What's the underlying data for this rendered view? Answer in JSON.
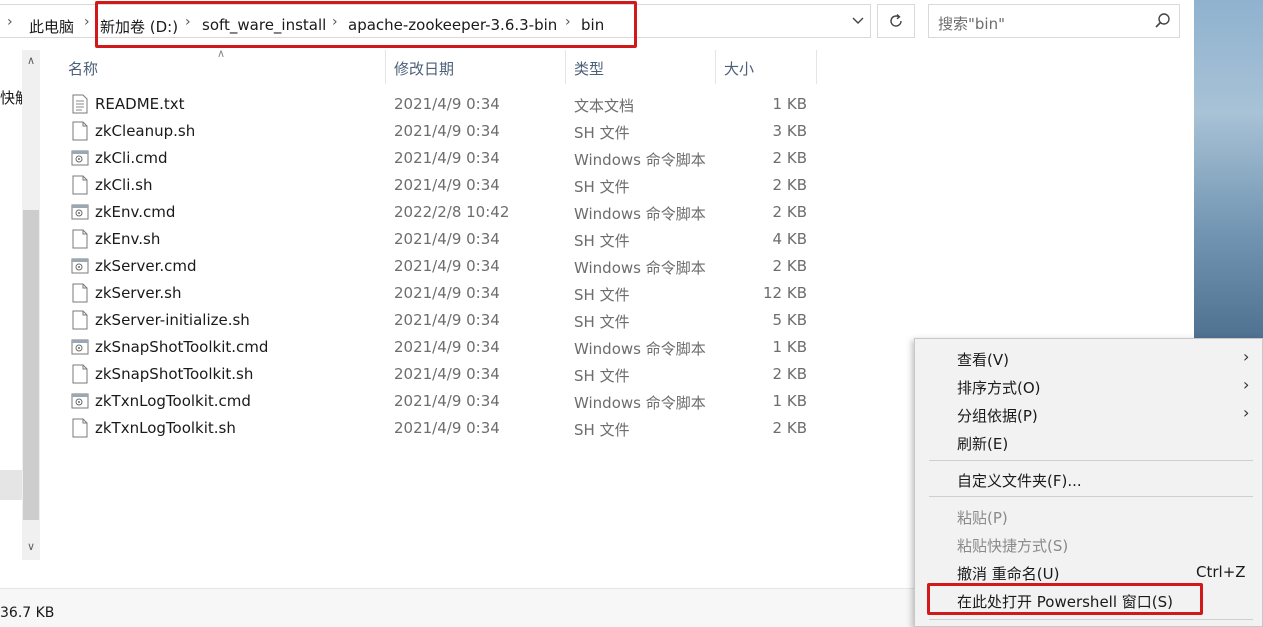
{
  "address_bar": {
    "breadcrumbs": [
      "此电脑",
      "新加卷 (D:)",
      "soft_ware_install",
      "apache-zookeeper-3.6.3-bin",
      "bin"
    ],
    "search_placeholder": "搜索\"bin\""
  },
  "nav": {
    "partial_text": "快解"
  },
  "columns": {
    "name": "名称",
    "date": "修改日期",
    "type": "类型",
    "size": "大小"
  },
  "files": [
    {
      "name": "README.txt",
      "date": "2021/4/9 0:34",
      "type": "文本文档",
      "size": "1 KB",
      "icon": "text-file-icon"
    },
    {
      "name": "zkCleanup.sh",
      "date": "2021/4/9 0:34",
      "type": "SH 文件",
      "size": "3 KB",
      "icon": "file-icon"
    },
    {
      "name": "zkCli.cmd",
      "date": "2021/4/9 0:34",
      "type": "Windows 命令脚本",
      "size": "2 KB",
      "icon": "cmd-script-icon"
    },
    {
      "name": "zkCli.sh",
      "date": "2021/4/9 0:34",
      "type": "SH 文件",
      "size": "2 KB",
      "icon": "file-icon"
    },
    {
      "name": "zkEnv.cmd",
      "date": "2022/2/8 10:42",
      "type": "Windows 命令脚本",
      "size": "2 KB",
      "icon": "cmd-script-icon"
    },
    {
      "name": "zkEnv.sh",
      "date": "2021/4/9 0:34",
      "type": "SH 文件",
      "size": "4 KB",
      "icon": "file-icon"
    },
    {
      "name": "zkServer.cmd",
      "date": "2021/4/9 0:34",
      "type": "Windows 命令脚本",
      "size": "2 KB",
      "icon": "cmd-script-icon"
    },
    {
      "name": "zkServer.sh",
      "date": "2021/4/9 0:34",
      "type": "SH 文件",
      "size": "12 KB",
      "icon": "file-icon"
    },
    {
      "name": "zkServer-initialize.sh",
      "date": "2021/4/9 0:34",
      "type": "SH 文件",
      "size": "5 KB",
      "icon": "file-icon"
    },
    {
      "name": "zkSnapShotToolkit.cmd",
      "date": "2021/4/9 0:34",
      "type": "Windows 命令脚本",
      "size": "1 KB",
      "icon": "cmd-script-icon"
    },
    {
      "name": "zkSnapShotToolkit.sh",
      "date": "2021/4/9 0:34",
      "type": "SH 文件",
      "size": "2 KB",
      "icon": "file-icon"
    },
    {
      "name": "zkTxnLogToolkit.cmd",
      "date": "2021/4/9 0:34",
      "type": "Windows 命令脚本",
      "size": "1 KB",
      "icon": "cmd-script-icon"
    },
    {
      "name": "zkTxnLogToolkit.sh",
      "date": "2021/4/9 0:34",
      "type": "SH 文件",
      "size": "2 KB",
      "icon": "file-icon"
    }
  ],
  "status": {
    "size_text": "36.7 KB"
  },
  "context_menu": {
    "items": [
      {
        "label": "查看(V)",
        "submenu": true
      },
      {
        "label": "排序方式(O)",
        "submenu": true
      },
      {
        "label": "分组依据(P)",
        "submenu": true
      },
      {
        "label": "刷新(E)"
      },
      {
        "label": "自定义文件夹(F)..."
      },
      {
        "label": "粘贴(P)",
        "disabled": true
      },
      {
        "label": "粘贴快捷方式(S)",
        "disabled": true
      },
      {
        "label": "撤消 重命名(U)",
        "shortcut": "Ctrl+Z"
      },
      {
        "label": "在此处打开 Powershell 窗口(S)"
      }
    ]
  },
  "colors": {
    "highlight": "#d21919",
    "header_text": "#4c607a",
    "menu_bg": "#f2f2f2"
  }
}
